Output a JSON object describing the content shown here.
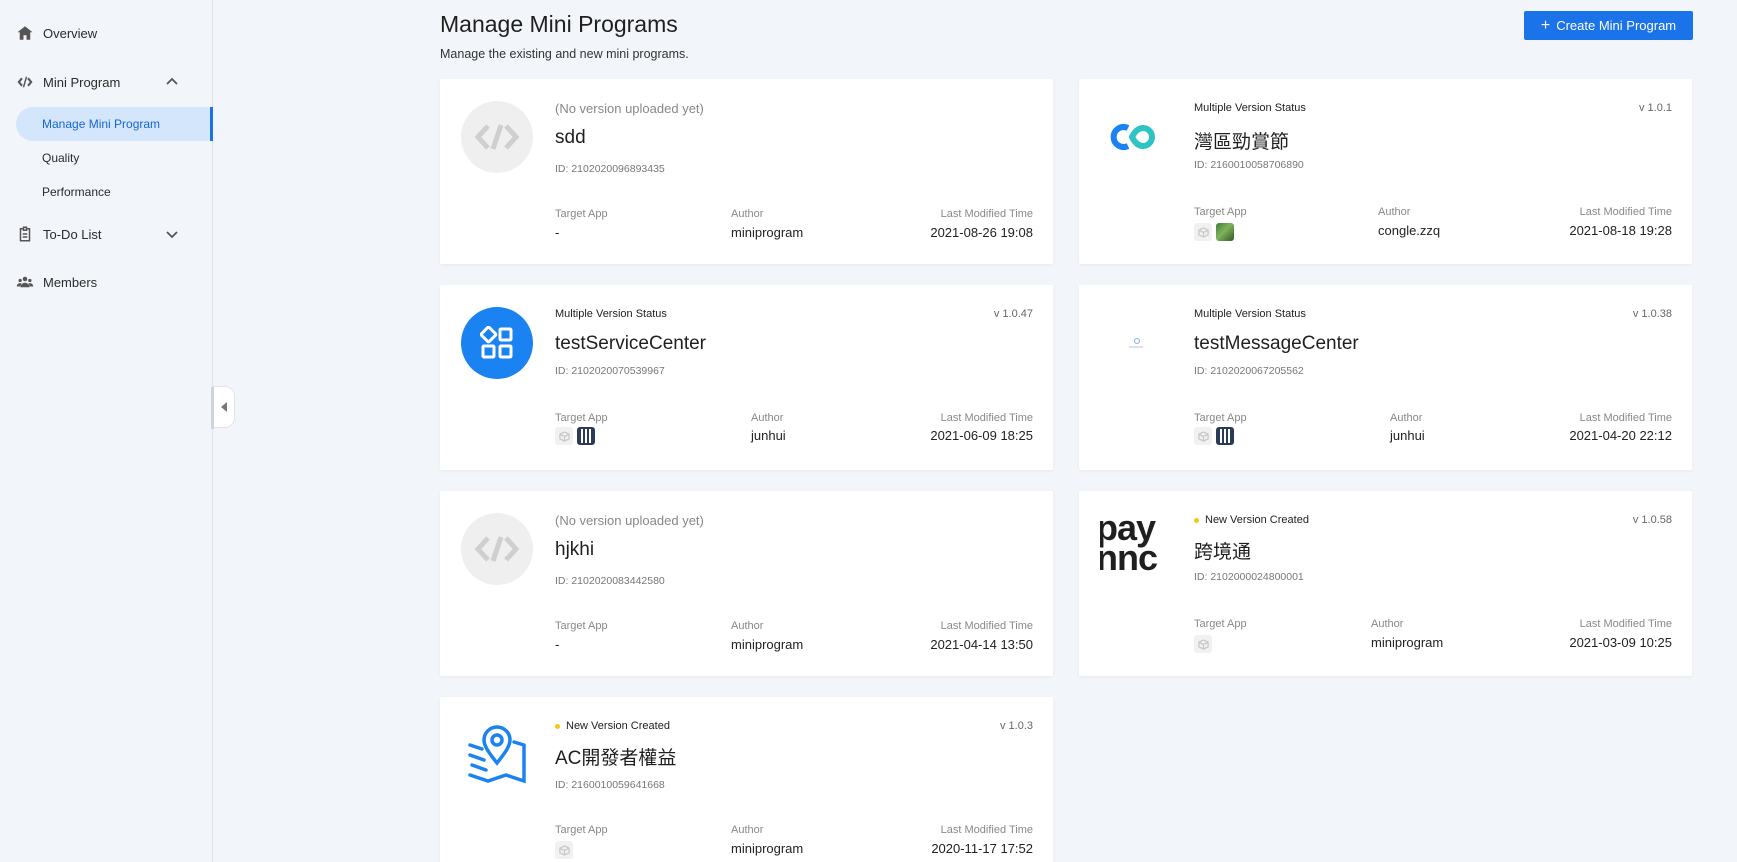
{
  "sidebar": {
    "overview": "Overview",
    "mini_program": "Mini Program",
    "sub_items": [
      "Manage Mini Program",
      "Quality",
      "Performance"
    ],
    "todo": "To-Do List",
    "members": "Members"
  },
  "header": {
    "title": "Manage Mini Programs",
    "subtitle": "Manage the existing and new mini programs.",
    "create_button": "Create Mini Program"
  },
  "labels": {
    "target_app": "Target App",
    "author": "Author",
    "last_modified": "Last Modified Time"
  },
  "cards": [
    {
      "status": "(No version uploaded yet)",
      "version": "",
      "name": "sdd",
      "id": "ID: 2102020096893435",
      "target_app": "-",
      "author": "miniprogram",
      "modified": "2021-08-26 19:08"
    },
    {
      "status": "Multiple Version Status",
      "version": "v 1.0.1",
      "name": "灣區勁賞節",
      "id": "ID: 2160010058706890",
      "target_app": "",
      "author": "congle.zzq",
      "modified": "2021-08-18 19:28"
    },
    {
      "status": "Multiple Version Status",
      "version": "v 1.0.47",
      "name": "testServiceCenter",
      "id": "ID: 2102020070539967",
      "target_app": "",
      "author": "junhui",
      "modified": "2021-06-09 18:25"
    },
    {
      "status": "Multiple Version Status",
      "version": "v 1.0.38",
      "name": "testMessageCenter",
      "id": "ID: 2102020067205562",
      "target_app": "",
      "author": "junhui",
      "modified": "2021-04-20 22:12"
    },
    {
      "status": "(No version uploaded yet)",
      "version": "",
      "name": "hjkhi",
      "id": "ID: 2102020083442580",
      "target_app": "-",
      "author": "miniprogram",
      "modified": "2021-04-14 13:50"
    },
    {
      "status": "New Version Created",
      "version": "v 1.0.58",
      "name": "跨境通",
      "id": "ID: 2102000024800001",
      "target_app": "",
      "author": "miniprogram",
      "modified": "2021-03-09 10:25"
    },
    {
      "status": "New Version Created",
      "version": "v 1.0.3",
      "name": "AC開發者權益",
      "id": "ID: 2160010059641668",
      "target_app": "",
      "author": "miniprogram",
      "modified": "2020-11-17 17:52"
    }
  ],
  "logo_text": {
    "paynow": "pay",
    "paynow2": "nnc"
  },
  "colors": {
    "accent": "#1a73e8",
    "active_bg": "#d3e6fb",
    "status_dot": "#f5c518"
  }
}
